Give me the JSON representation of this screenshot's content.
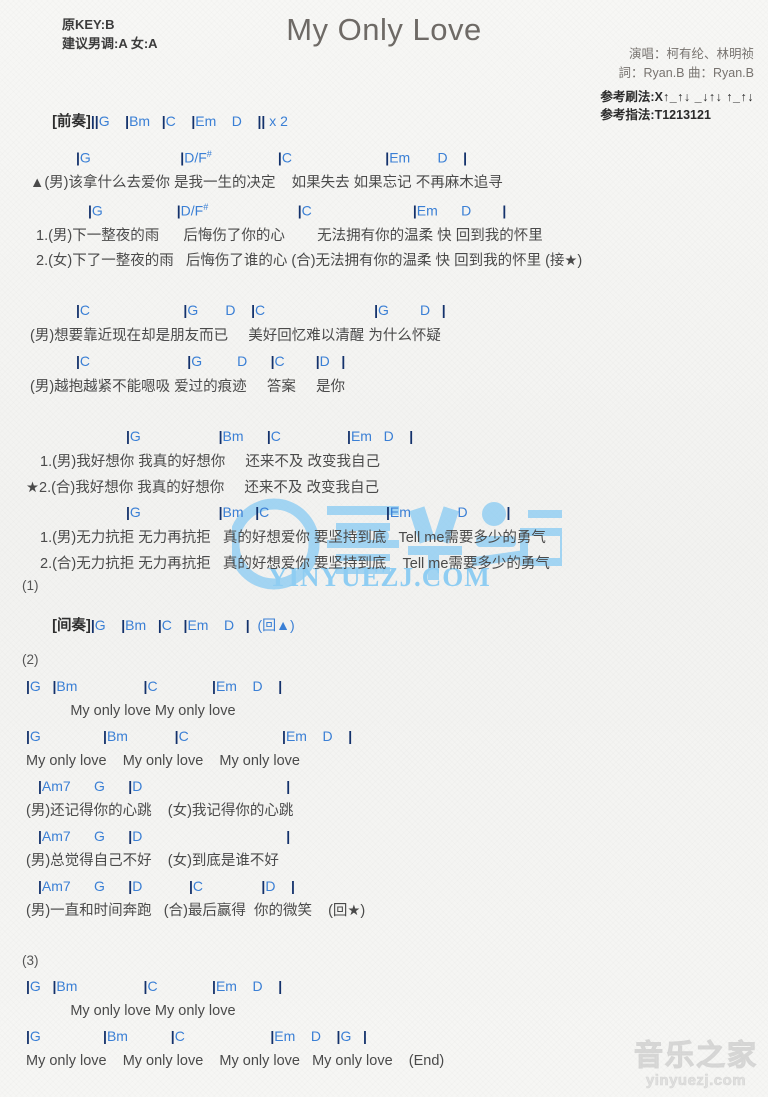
{
  "header": {
    "orig_key": "原KEY:B",
    "suggest_key": "建议男调:A 女:A",
    "title": "My Only Love",
    "singer": "演唱：柯有纶、林明祯",
    "writer": "詞：Ryan.B  曲：Ryan.B",
    "strum_label": "参考刷法:X",
    "strum_pattern": "↑_↑↓ _↓↑↓ ↑_↑↓",
    "finger_label": "参考指法:",
    "finger_pattern": "T1213121"
  },
  "intro": {
    "tag": "[前奏]",
    "line": "||G    |Bm   |C    |Em    D    || x 2"
  },
  "sections": {
    "verse_a_chords": "|G                       |D/F#                 |C                        |Em       D    |",
    "verse_a_lyric": "▲(男)该拿什么去爱你 是我一生的决定    如果失去 如果忘记 不再麻木追寻",
    "verse_b_chords": "|G                   |D/F#                       |C                          |Em      D        |",
    "verse_b_lyric1": "1.(男)下一整夜的雨      后悔伤了你的心        无法拥有你的温柔 快 回到我的怀里",
    "verse_b_lyric2": "2.(女)下了一整夜的雨   后悔伤了谁的心 (合)无法拥有你的温柔 快 回到我的怀里 (接★)",
    "pre_chorus1_chords": "|C                        |G       D    |C                            |G        D   |",
    "pre_chorus1_lyric": "(男)想要靠近现在却是朋友而已     美好回忆难以清醒 为什么怀疑",
    "pre_chorus2_chords": "|C                         |G         D      |C        |D   |",
    "pre_chorus2_lyric": "(男)越抱越紧不能嗯吸 爱过的痕迹     答案     是你",
    "chorus1_chords": "|G                    |Bm      |C                 |Em   D    |",
    "chorus1_lyric1": "1.(男)我好想你 我真的好想你     还来不及 改变我自己",
    "chorus1_lyric2": "★2.(合)我好想你 我真的好想你     还来不及 改变我自己",
    "chorus2_chords": "|G                    |Bm   |C                              |Em            D          |",
    "chorus2_lyric1": "1.(男)无力抗拒 无力再抗拒   真的好想爱你 要坚持到底   Tell me需要多少的勇气",
    "chorus2_lyric2": "2.(合)无力抗拒 无力再抗拒   真的好想爱你 要坚持到底    Tell me需要多少的勇气",
    "marker1": "(1)",
    "interlude_tag": "[间奏]",
    "interlude_line": "|G    |Bm   |C   |Em    D   |  (回▲)",
    "marker2": "(2)",
    "s2_l1_chords": "|G   |Bm                 |C              |Em    D    |",
    "s2_l1_lyric": "           My only love My only love",
    "s2_l2_chords": "|G                |Bm            |C                        |Em    D    |",
    "s2_l2_lyric": "My only love    My only love    My only love",
    "s2_l3_chords": "|Am7      G      |D                                     |",
    "s2_l3_lyric": "(男)还记得你的心跳    (女)我记得你的心跳",
    "s2_l4_chords": "|Am7      G      |D                                     |",
    "s2_l4_lyric": "(男)总觉得自己不好    (女)到底是谁不好",
    "s2_l5_chords": "|Am7      G      |D            |C               |D    |",
    "s2_l5_lyric": "(男)一直和时间奔跑   (合)最后赢得  你的微笑    (回★)",
    "marker3": "(3)",
    "s3_l1_chords": "|G   |Bm                 |C              |Em    D    |",
    "s3_l1_lyric": "           My only love My only love",
    "s3_l2_chords": "|G                |Bm           |C                      |Em    D    |G   |",
    "s3_l2_lyric": "My only love    My only love    My only love   My only love    (End)"
  },
  "watermark": {
    "site_text": "YINYUEZJ.COM",
    "logo_cn": "音乐之家",
    "logo_en": "yinyuezj.com"
  },
  "colors": {
    "chord": "#3a7fd5",
    "barline": "#13316b",
    "lyric": "#4a4a4a",
    "title": "#6e6a66",
    "watermark": "#8fcdf2",
    "background": "#f5f5f3"
  }
}
